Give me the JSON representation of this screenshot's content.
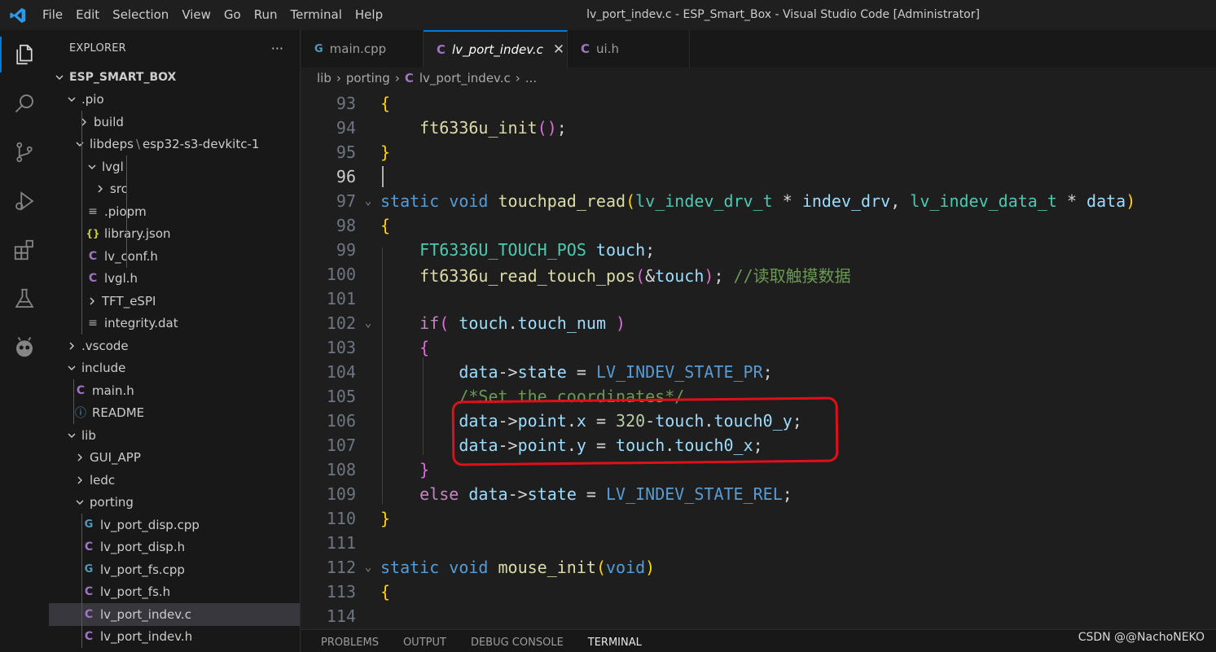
{
  "window": {
    "title": "lv_port_indev.c - ESP_Smart_Box - Visual Studio Code [Administrator]"
  },
  "menu": [
    "File",
    "Edit",
    "Selection",
    "View",
    "Go",
    "Run",
    "Terminal",
    "Help"
  ],
  "activity_bar": [
    "files-icon",
    "search-icon",
    "source-control-icon",
    "run-debug-icon",
    "extensions-icon",
    "testing-icon",
    "platformio-icon"
  ],
  "explorer": {
    "title": "EXPLORER",
    "more": "···",
    "items": [
      {
        "label": "ESP_SMART_BOX",
        "kind": "root",
        "state": "open"
      },
      {
        "label": ".pio",
        "kind": "folder",
        "state": "open"
      },
      {
        "label": "build",
        "kind": "folder",
        "state": "closed"
      },
      {
        "label": "libdeps",
        "sep": "\\",
        "label2": "esp32-s3-devkitc-1",
        "kind": "folder",
        "state": "open"
      },
      {
        "label": "lvgl",
        "kind": "folder",
        "state": "open"
      },
      {
        "label": "src",
        "kind": "folder",
        "state": "closed"
      },
      {
        "label": ".piopm",
        "kind": "file-lines"
      },
      {
        "label": "library.json",
        "kind": "file-json"
      },
      {
        "label": "lv_conf.h",
        "kind": "file-c"
      },
      {
        "label": "lvgl.h",
        "kind": "file-c"
      },
      {
        "label": "TFT_eSPI",
        "kind": "folder",
        "state": "closed"
      },
      {
        "label": "integrity.dat",
        "kind": "file-lines"
      },
      {
        "label": ".vscode",
        "kind": "folder",
        "state": "closed"
      },
      {
        "label": "include",
        "kind": "folder",
        "state": "open"
      },
      {
        "label": "main.h",
        "kind": "file-c"
      },
      {
        "label": "README",
        "kind": "file-info"
      },
      {
        "label": "lib",
        "kind": "folder",
        "state": "open"
      },
      {
        "label": "GUI_APP",
        "kind": "folder",
        "state": "closed"
      },
      {
        "label": "ledc",
        "kind": "folder",
        "state": "closed"
      },
      {
        "label": "porting",
        "kind": "folder",
        "state": "open"
      },
      {
        "label": "lv_port_disp.cpp",
        "kind": "file-cpp"
      },
      {
        "label": "lv_port_disp.h",
        "kind": "file-c"
      },
      {
        "label": "lv_port_fs.cpp",
        "kind": "file-cpp"
      },
      {
        "label": "lv_port_fs.h",
        "kind": "file-c"
      },
      {
        "label": "lv_port_indev.c",
        "kind": "file-c",
        "selected": true
      },
      {
        "label": "lv_port_indev.h",
        "kind": "file-c"
      }
    ]
  },
  "tabs": [
    {
      "label": "main.cpp",
      "icon": "G",
      "active": false
    },
    {
      "label": "lv_port_indev.c",
      "icon": "C",
      "active": true,
      "close": "✕"
    },
    {
      "label": "ui.h",
      "icon": "C",
      "active": false
    }
  ],
  "breadcrumb": {
    "parts": [
      "lib",
      "porting",
      "lv_port_indev.c",
      "..."
    ],
    "sep": "›"
  },
  "code_lines": [
    {
      "n": "93"
    },
    {
      "n": "94"
    },
    {
      "n": "95"
    },
    {
      "n": "96"
    },
    {
      "n": "97"
    },
    {
      "n": "98"
    },
    {
      "n": "99"
    },
    {
      "n": "100"
    },
    {
      "n": "101"
    },
    {
      "n": "102"
    },
    {
      "n": "103"
    },
    {
      "n": "104"
    },
    {
      "n": "105"
    },
    {
      "n": "106"
    },
    {
      "n": "107"
    },
    {
      "n": "108"
    },
    {
      "n": "109"
    },
    {
      "n": "110"
    },
    {
      "n": "111"
    },
    {
      "n": "112"
    },
    {
      "n": "113"
    },
    {
      "n": "114"
    }
  ],
  "code": {
    "l93": "{",
    "l94_fn": "ft6336u_init",
    "l95": "}",
    "l97_kw": "static",
    "l97_void": "void",
    "l97_fn": "touchpad_read",
    "l97_t1": "lv_indev_drv_t",
    "l97_p1": "indev_drv",
    "l97_t2": "lv_indev_data_t",
    "l97_p2": "data",
    "l99_type": "FT6336U_TOUCH_POS",
    "l99_var": "touch",
    "l100_fn": "ft6336u_read_touch_pos",
    "l100_arg": "touch",
    "l100_cm": "//读取触摸数据",
    "l102_if": "if",
    "l102_a": "touch",
    "l102_b": "touch_num",
    "l104_a": "data",
    "l104_b": "state",
    "l104_c": "LV_INDEV_STATE_PR",
    "l105_cm": "/*Set the coordinates*/",
    "l106_a": "data",
    "l106_b": "point",
    "l106_c": "x",
    "l106_num": "320",
    "l106_d": "touch",
    "l106_e": "touch0_y",
    "l107_a": "data",
    "l107_b": "point",
    "l107_c": "y",
    "l107_d": "touch",
    "l107_e": "touch0_x",
    "l109_else": "else",
    "l109_a": "data",
    "l109_b": "state",
    "l109_c": "LV_INDEV_STATE_REL",
    "l112_kw": "static",
    "l112_void": "void",
    "l112_fn": "mouse_init",
    "l112_arg": "void"
  },
  "panel_tabs": [
    "PROBLEMS",
    "OUTPUT",
    "DEBUG CONSOLE",
    "TERMINAL"
  ],
  "watermark": "CSDN @@NachoNEKO",
  "colors": {
    "accent": "#0078d4",
    "highlight_box": "#e0101a"
  }
}
